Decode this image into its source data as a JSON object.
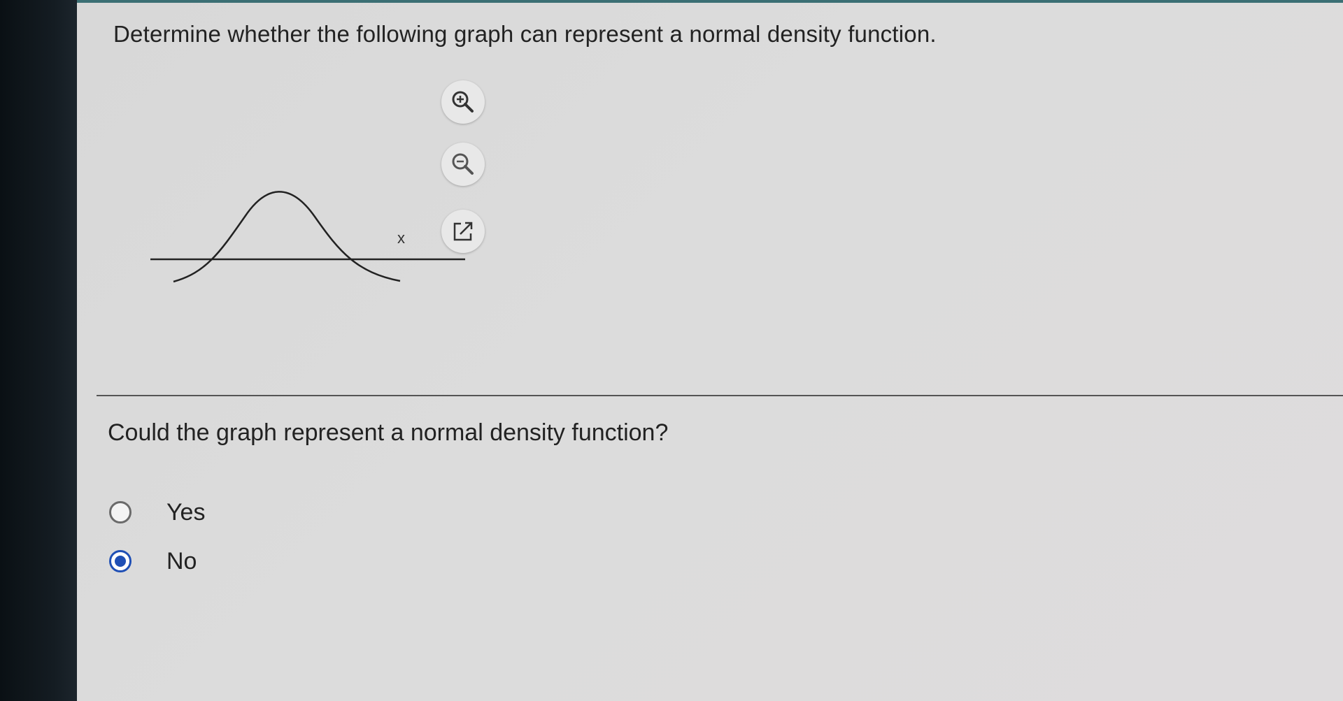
{
  "question": {
    "text": "Determine whether the following graph can represent a normal density function."
  },
  "graph": {
    "x_axis_label": "x"
  },
  "toolbar": {
    "zoom_in_icon": "zoom-in-icon",
    "zoom_out_icon": "zoom-out-icon",
    "popout_icon": "external-link-icon"
  },
  "prompt": {
    "text": "Could the graph represent a normal density function?"
  },
  "options": [
    {
      "label": "Yes",
      "selected": false
    },
    {
      "label": "No",
      "selected": true
    }
  ],
  "colors": {
    "accent": "#1f4fb5",
    "top_strip": "#3b6f74"
  }
}
